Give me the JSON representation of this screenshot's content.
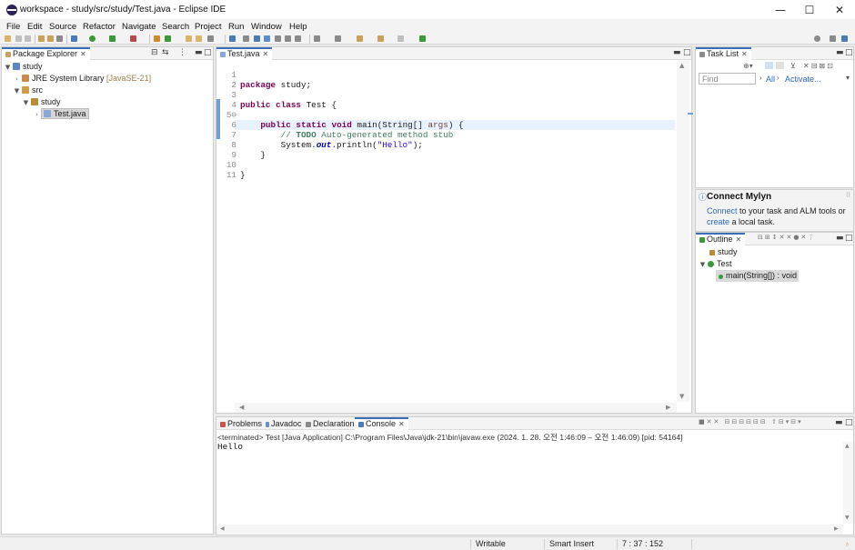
{
  "window": {
    "title": "workspace - study/src/study/Test.java - Eclipse IDE",
    "controls": {
      "minimize": "—",
      "maximize": "☐",
      "close": "✕"
    }
  },
  "menu": [
    "File",
    "Edit",
    "Source",
    "Refactor",
    "Navigate",
    "Search",
    "Project",
    "Run",
    "Window",
    "Help"
  ],
  "package_explorer": {
    "tab_label": "Package Explorer",
    "tree": [
      {
        "label": "study",
        "expanded": true
      },
      {
        "label": "JRE System Library",
        "suffix": "[JavaSE-21]",
        "expanded": false
      },
      {
        "label": "src",
        "expanded": true
      },
      {
        "label": "study",
        "expanded": true
      },
      {
        "label": "Test.java",
        "expanded": false,
        "selected": true
      }
    ]
  },
  "editor": {
    "tab_label": "Test.java",
    "lines": [
      {
        "num": "1",
        "text": "package study;"
      },
      {
        "num": "2",
        "text": ""
      },
      {
        "num": "3",
        "text": "public class Test {"
      },
      {
        "num": "4",
        "text": ""
      },
      {
        "num": "5⊖",
        "text": "public static void main(String[] args) {"
      },
      {
        "num": "6",
        "text": "// TODO Auto-generated method stub"
      },
      {
        "num": "7",
        "text": "System.out.println(\"Hello\");"
      },
      {
        "num": "8",
        "text": "}"
      },
      {
        "num": "9",
        "text": ""
      },
      {
        "num": "10",
        "text": "}"
      },
      {
        "num": "11",
        "text": ""
      }
    ]
  },
  "task_list": {
    "tab_label": "Task List",
    "find_placeholder": "Find",
    "filter_all": "All",
    "activate": "Activate..."
  },
  "mylyn": {
    "title": "Connect Mylyn",
    "connect_link": "Connect",
    "text1": " to your task and ALM tools or",
    "create_link": "create",
    "text2": " a local task."
  },
  "outline": {
    "tab_label": "Outline",
    "items": [
      {
        "label": "study",
        "kind": "package"
      },
      {
        "label": "Test",
        "kind": "class"
      },
      {
        "label": "main(String[]) : void",
        "kind": "method"
      }
    ]
  },
  "bottom_tabs": {
    "problems": "Problems",
    "javadoc": "Javadoc",
    "declaration": "Declaration",
    "console": "Console"
  },
  "console": {
    "header": "<terminated> Test [Java Application] C:\\Program Files\\Java\\jdk-21\\bin\\javaw.exe  (2024. 1. 28. 오전 1:46:09 – 오전 1:46:09) [pid: 54164]",
    "output": "Hello"
  },
  "status_bar": {
    "writable": "Writable",
    "insert_mode": "Smart Insert",
    "position": "7 : 37 : 152"
  },
  "colors": {
    "keyword": "#7f0055",
    "comment": "#3f7f5f",
    "string": "#2a00ff",
    "link": "#2d6bbf",
    "active_tab": "#3b6fb6"
  }
}
